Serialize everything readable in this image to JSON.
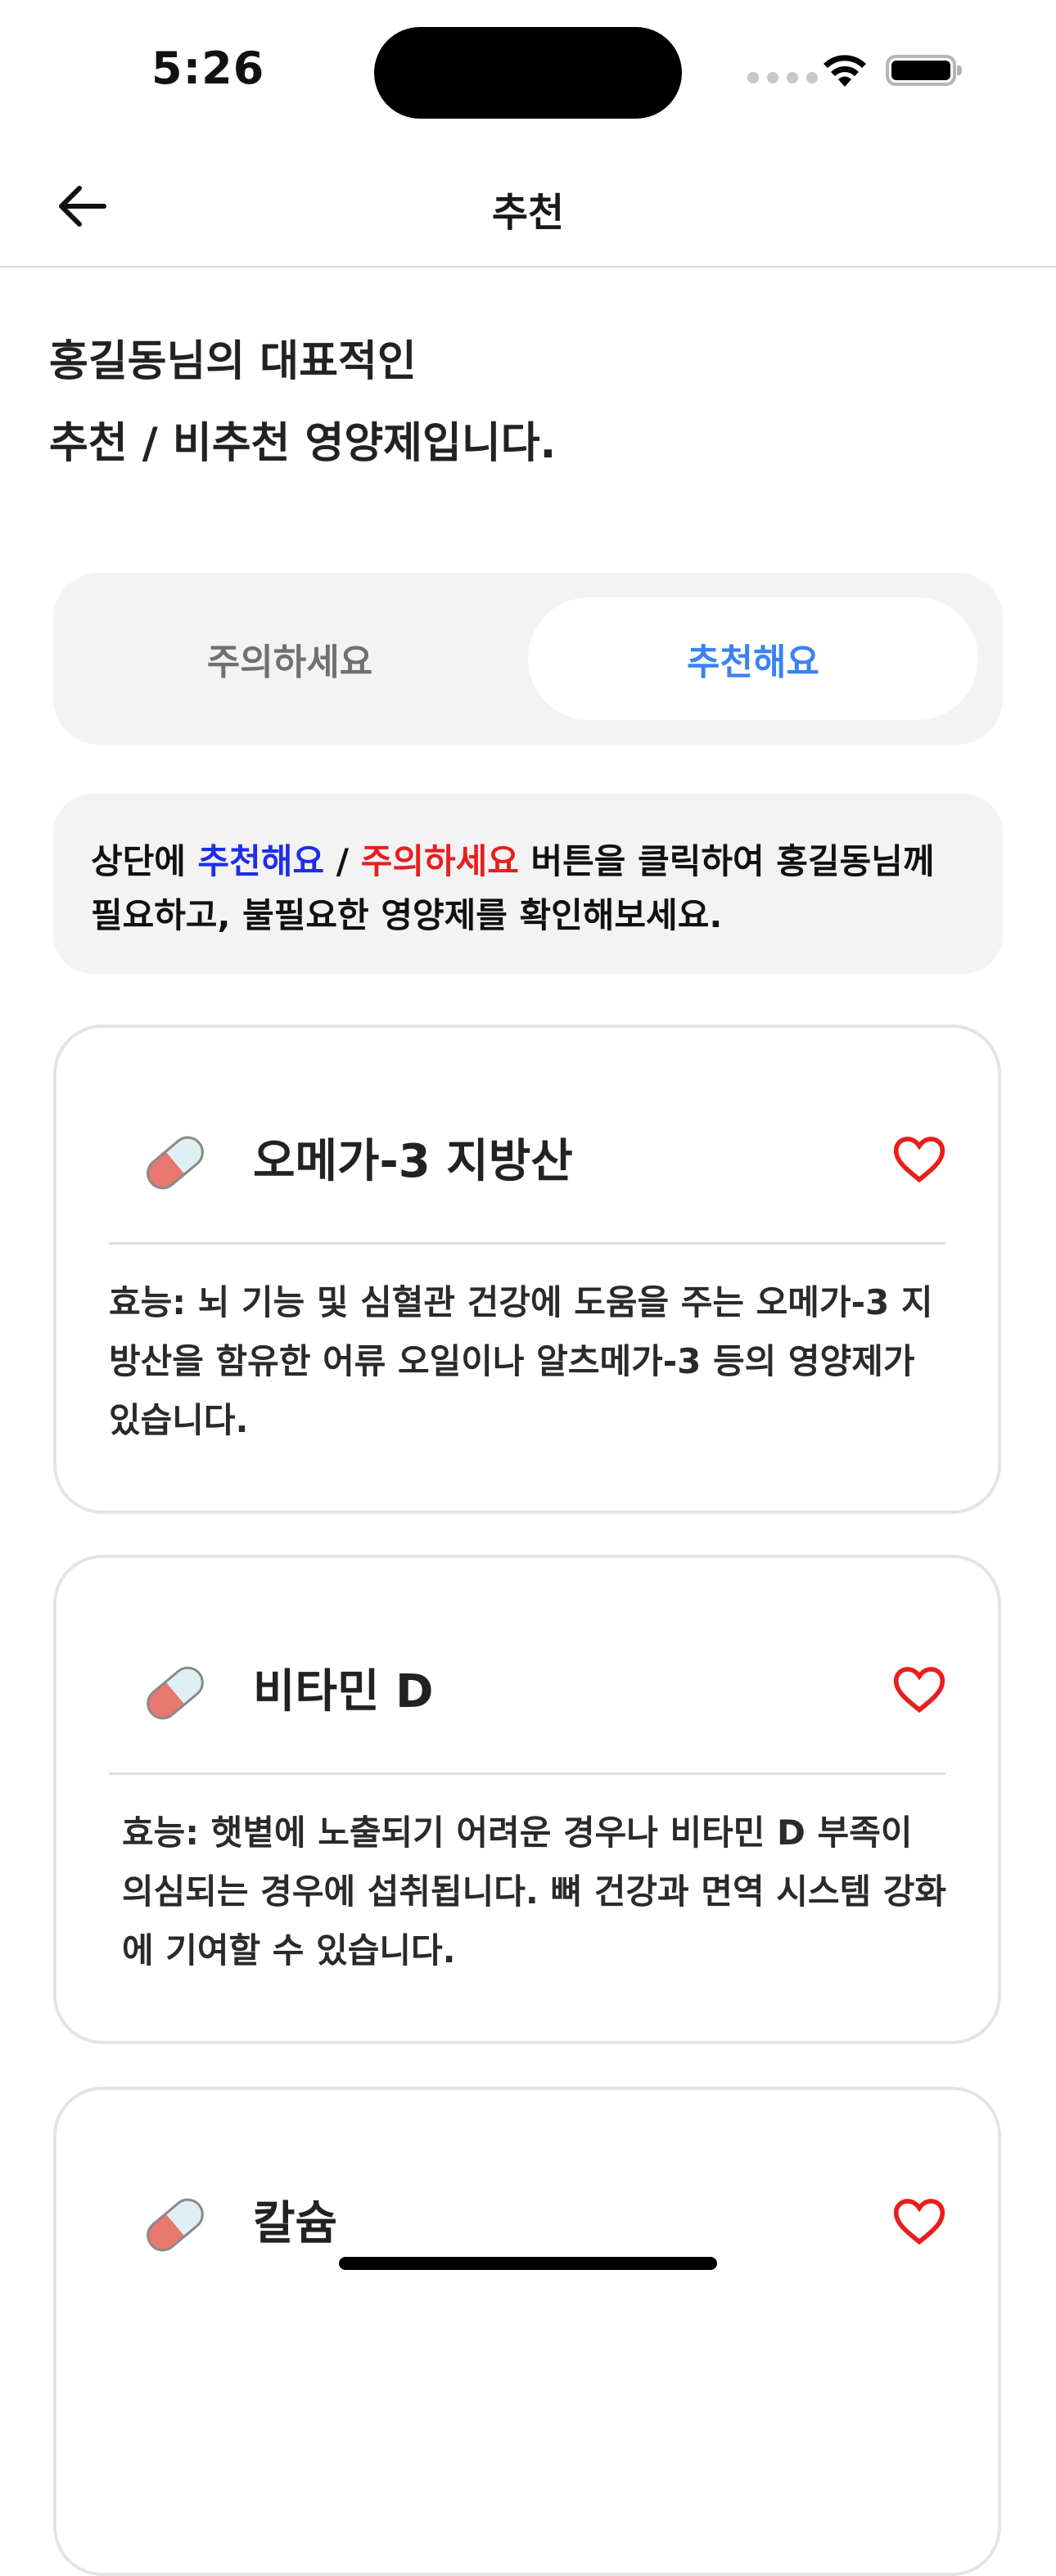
{
  "status": {
    "time": "5:26"
  },
  "header": {
    "title": "추천"
  },
  "intro": {
    "line1": "홍길동님의 대표적인",
    "line2": "추천 / 비추천 영양제입니다."
  },
  "segmented": {
    "caution_label": "주의하세요",
    "recommend_label": "추천해요",
    "selected": "추천해요"
  },
  "notice": {
    "prefix": "상단에 ",
    "recommend": "추천해요",
    "sep": " / ",
    "caution": "주의하세요",
    "suffix": " 버튼을 클릭하여 홍길동님께 필요하고, 불필요한 영양제를 확인해보세요."
  },
  "colors": {
    "accent_blue": "#3b82f0",
    "notice_blue": "#1e2ee8",
    "notice_red": "#e81e1e",
    "heart": "#e81e1e"
  },
  "supplements": [
    {
      "name": "오메가-3 지방산",
      "icon": "pill-icon",
      "favorite_icon": "heart-outline-icon",
      "description": "효능: 뇌 기능 및 심혈관 건강에 도움을 주는 오메가-3 지방산을 함유한 어류 오일이나 알츠메가-3 등의 영양제가 있습니다."
    },
    {
      "name": "비타민 D",
      "icon": "pill-icon",
      "favorite_icon": "heart-outline-icon",
      "description": "효능: 햇볕에 노출되기 어려운 경우나 비타민 D 부족이 의심되는 경우에 섭취됩니다. 뼈 건강과 면역 시스템 강화에 기여할 수 있습니다."
    },
    {
      "name": "칼슘",
      "icon": "pill-icon",
      "favorite_icon": "heart-outline-icon",
      "description": ""
    }
  ]
}
